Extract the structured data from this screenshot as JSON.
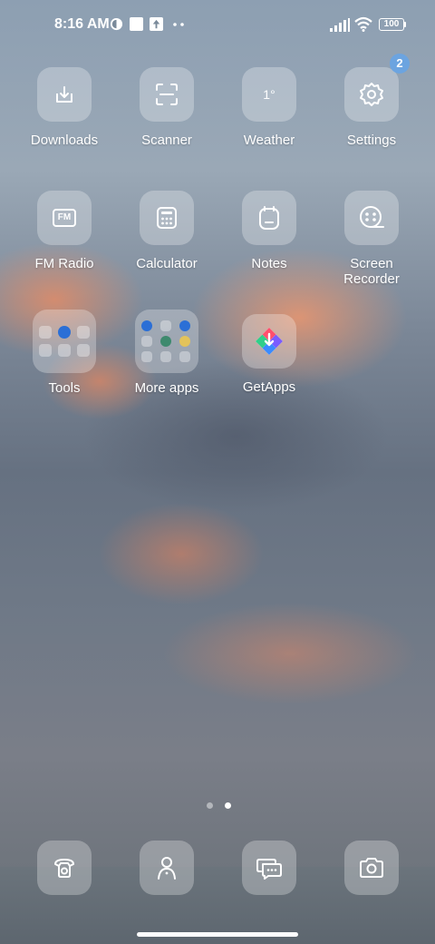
{
  "status_bar": {
    "time": "8:16 AM",
    "battery": "100",
    "icons": [
      "theme-icon",
      "notification-square-icon",
      "upload-icon",
      "more-dots-icon",
      "signal-icon",
      "wifi-icon",
      "battery-icon"
    ]
  },
  "apps": [
    {
      "label": "Downloads",
      "icon": "download-icon"
    },
    {
      "label": "Scanner",
      "icon": "scanner-icon"
    },
    {
      "label": "Weather",
      "icon": "weather-icon",
      "tile_text": "1°"
    },
    {
      "label": "Settings",
      "icon": "gear-icon",
      "badge": "2"
    },
    {
      "label": "FM Radio",
      "icon": "radio-icon",
      "tile_text": "FM"
    },
    {
      "label": "Calculator",
      "icon": "calculator-icon"
    },
    {
      "label": "Notes",
      "icon": "notes-icon"
    },
    {
      "label": "Screen\nRecorder",
      "icon": "screen-recorder-icon"
    },
    {
      "label": "Tools",
      "icon": "folder-icon"
    },
    {
      "label": "More apps",
      "icon": "folder-icon"
    },
    {
      "label": "GetApps",
      "icon": "getapps-icon"
    }
  ],
  "dock": [
    {
      "name": "phone",
      "icon": "phone-icon"
    },
    {
      "name": "contacts",
      "icon": "contacts-icon"
    },
    {
      "name": "messages",
      "icon": "messages-icon"
    },
    {
      "name": "camera",
      "icon": "camera-icon"
    }
  ],
  "pager": {
    "count": 2,
    "active": 2
  },
  "colors": {
    "badge": "#6ca4e0",
    "tile": "rgba(255,255,255,0.28)"
  }
}
